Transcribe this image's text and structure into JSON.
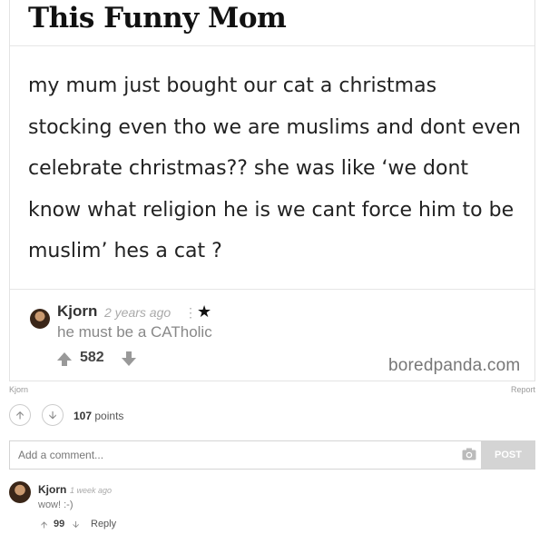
{
  "post": {
    "title": "This Funny Mom",
    "text": "my mum just bought our cat a christmas stocking even tho we are muslims and dont even celebrate christmas?? she was like ‘we dont know what religion he is we cant force him to be muslim’ hes a cat ?",
    "comment": {
      "author": "Kjorn",
      "time": "2 years ago",
      "kebab": "⋮",
      "star": "★",
      "text": "he must be a CATholic",
      "votes": "582"
    },
    "watermark": "boredpanda.com"
  },
  "meta": {
    "uploader": "Kjorn",
    "report": "Report"
  },
  "voting": {
    "upvote_icon": "arrow-up-icon",
    "downvote_icon": "arrow-down-icon",
    "points": "107",
    "points_label": "points"
  },
  "comment_form": {
    "placeholder": "Add a comment...",
    "camera_icon": "camera-icon",
    "post_label": "POST"
  },
  "comments": [
    {
      "author": "Kjorn",
      "time": "1 week ago",
      "text": "wow! :-)",
      "votes": "99",
      "reply_label": "Reply"
    }
  ]
}
